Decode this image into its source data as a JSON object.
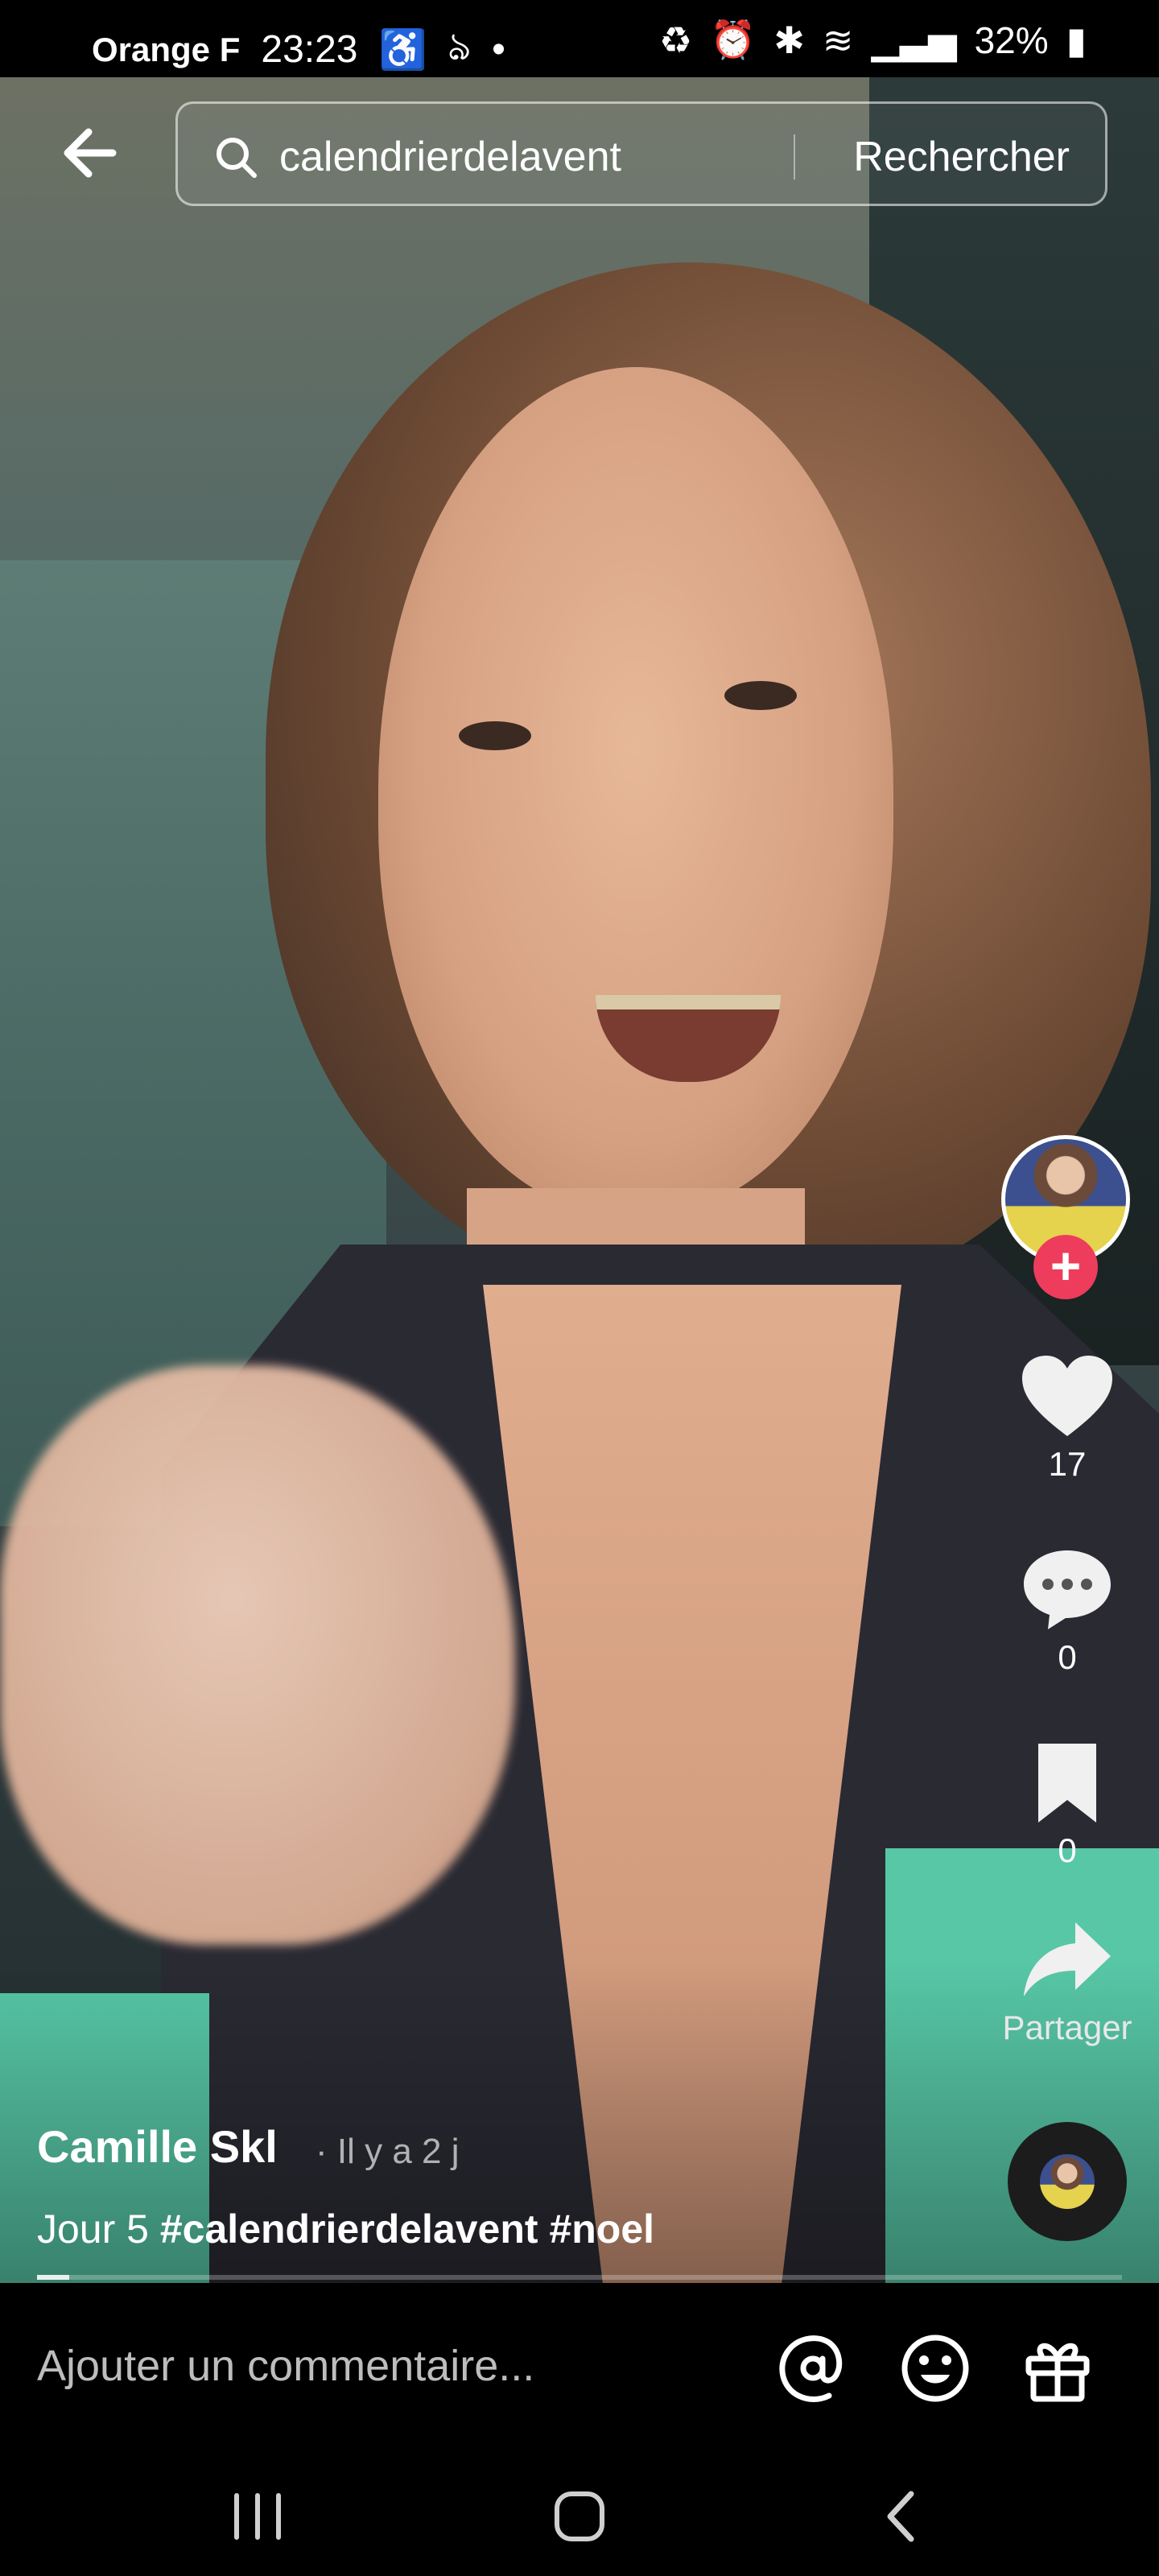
{
  "status_bar": {
    "carrier": "Orange F",
    "time": "23:23",
    "battery": "32%"
  },
  "search": {
    "query": "calendrierdelavent",
    "button_label": "Rechercher"
  },
  "video": {
    "author": "Camille  Skl",
    "posted": "· Il y a 2 j",
    "caption_text": "Jour 5",
    "caption_tags": "#calendrierdelavent #noel",
    "progress": 0.03
  },
  "actions": {
    "likes": "17",
    "comments": "0",
    "saves": "0",
    "share_label": "Partager"
  },
  "comment_bar": {
    "placeholder": "Ajouter un commentaire..."
  },
  "icons": {
    "back": "arrow-left-icon",
    "search": "search-icon",
    "like": "heart-icon",
    "comment": "comment-bubble-icon",
    "save": "bookmark-icon",
    "share": "share-arrow-icon",
    "mention": "at-icon",
    "emoji": "emoji-icon",
    "gift": "gift-icon"
  },
  "colors": {
    "follow_button": "#ee3c5c",
    "background": "#000000"
  }
}
